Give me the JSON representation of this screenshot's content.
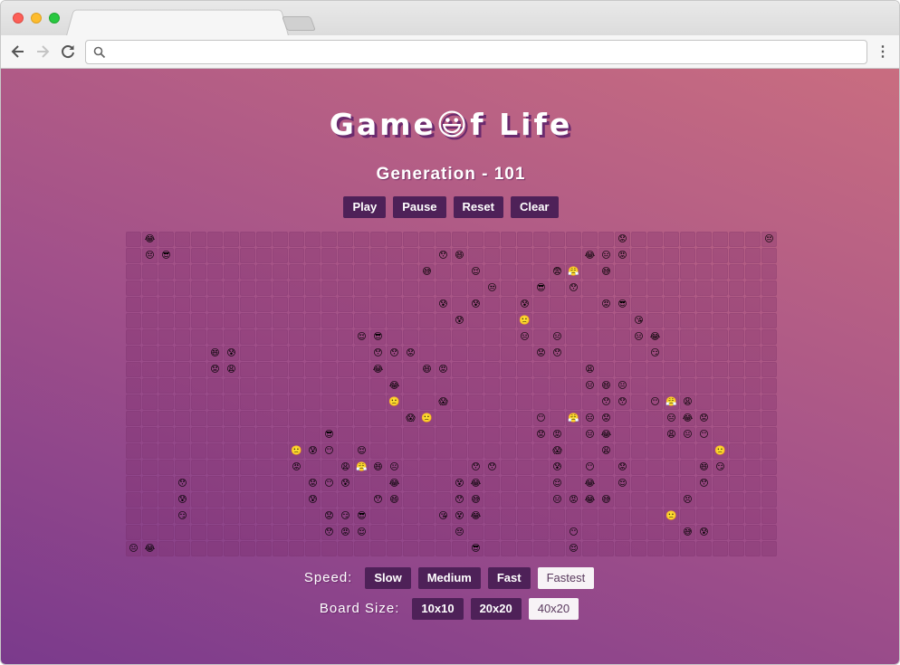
{
  "browser": {
    "url": "",
    "icons": {
      "back": "arrow-left-icon",
      "forward": "arrow-right-icon",
      "reload": "reload-icon",
      "search": "search-icon",
      "menu": "kebab-menu-icon"
    }
  },
  "game": {
    "title_a": "Game",
    "title_emoji": "😃",
    "title_b": "f Life",
    "generation_label": "Generation - 101",
    "controls": {
      "play": "Play",
      "pause": "Pause",
      "reset": "Reset",
      "clear": "Clear"
    },
    "speed": {
      "label": "Speed:",
      "options": [
        "Slow",
        "Medium",
        "Fast",
        "Fastest"
      ],
      "selected": "Fastest"
    },
    "board_size": {
      "label": "Board Size:",
      "options": [
        "10x10",
        "20x20",
        "40x20"
      ],
      "selected": "40x20"
    }
  },
  "board": {
    "cols": 40,
    "rows": 20,
    "alive": [
      [
        0,
        1,
        "😂"
      ],
      [
        0,
        30,
        "😟"
      ],
      [
        0,
        39,
        "😔"
      ],
      [
        1,
        1,
        "😔"
      ],
      [
        1,
        2,
        "😎"
      ],
      [
        1,
        19,
        "😯"
      ],
      [
        1,
        20,
        "😄"
      ],
      [
        1,
        28,
        "😂"
      ],
      [
        1,
        29,
        "😑"
      ],
      [
        1,
        30,
        "😡"
      ],
      [
        2,
        18,
        "😅"
      ],
      [
        2,
        21,
        "😌"
      ],
      [
        2,
        26,
        "😨"
      ],
      [
        2,
        27,
        "😤"
      ],
      [
        2,
        29,
        "😅"
      ],
      [
        3,
        22,
        "😒"
      ],
      [
        3,
        25,
        "😎"
      ],
      [
        3,
        27,
        "😯"
      ],
      [
        4,
        19,
        "😰"
      ],
      [
        4,
        21,
        "😰"
      ],
      [
        4,
        24,
        "😰"
      ],
      [
        4,
        29,
        "😡"
      ],
      [
        4,
        30,
        "😎"
      ],
      [
        5,
        20,
        "😰"
      ],
      [
        5,
        24,
        "🙁"
      ],
      [
        5,
        31,
        "😘"
      ],
      [
        6,
        14,
        "😌"
      ],
      [
        6,
        15,
        "😎"
      ],
      [
        6,
        24,
        "😑"
      ],
      [
        6,
        26,
        "😑"
      ],
      [
        6,
        31,
        "😑"
      ],
      [
        6,
        32,
        "😂"
      ],
      [
        7,
        5,
        "😄"
      ],
      [
        7,
        6,
        "😰"
      ],
      [
        7,
        15,
        "😯"
      ],
      [
        7,
        16,
        "😯"
      ],
      [
        7,
        17,
        "😟"
      ],
      [
        7,
        25,
        "😟"
      ],
      [
        7,
        26,
        "😯"
      ],
      [
        7,
        32,
        "😏"
      ],
      [
        8,
        5,
        "😟"
      ],
      [
        8,
        6,
        "😩"
      ],
      [
        8,
        15,
        "😂"
      ],
      [
        8,
        18,
        "😄"
      ],
      [
        8,
        19,
        "😡"
      ],
      [
        8,
        28,
        "😩"
      ],
      [
        9,
        16,
        "😂"
      ],
      [
        9,
        28,
        "😑"
      ],
      [
        9,
        29,
        "😄"
      ],
      [
        9,
        30,
        "😐"
      ],
      [
        10,
        16,
        "🙁"
      ],
      [
        10,
        19,
        "😱"
      ],
      [
        10,
        29,
        "😯"
      ],
      [
        10,
        30,
        "😯"
      ],
      [
        10,
        32,
        "😶"
      ],
      [
        10,
        33,
        "😤"
      ],
      [
        10,
        34,
        "😩"
      ],
      [
        11,
        17,
        "😱"
      ],
      [
        11,
        18,
        "🙁"
      ],
      [
        11,
        25,
        "😶"
      ],
      [
        11,
        27,
        "😤"
      ],
      [
        11,
        28,
        "😑"
      ],
      [
        11,
        29,
        "😟"
      ],
      [
        11,
        33,
        "😑"
      ],
      [
        11,
        34,
        "😂"
      ],
      [
        11,
        35,
        "😟"
      ],
      [
        12,
        12,
        "😎"
      ],
      [
        12,
        25,
        "😟"
      ],
      [
        12,
        26,
        "😡"
      ],
      [
        12,
        28,
        "😑"
      ],
      [
        12,
        29,
        "😂"
      ],
      [
        12,
        33,
        "😩"
      ],
      [
        12,
        34,
        "😐"
      ],
      [
        12,
        35,
        "😶"
      ],
      [
        13,
        10,
        "🙁"
      ],
      [
        13,
        11,
        "😰"
      ],
      [
        13,
        12,
        "😶"
      ],
      [
        13,
        14,
        "😌"
      ],
      [
        13,
        26,
        "😱"
      ],
      [
        13,
        29,
        "😩"
      ],
      [
        13,
        36,
        "🙁"
      ],
      [
        14,
        10,
        "😡"
      ],
      [
        14,
        13,
        "😩"
      ],
      [
        14,
        14,
        "😤"
      ],
      [
        14,
        15,
        "😄"
      ],
      [
        14,
        16,
        "😐"
      ],
      [
        14,
        21,
        "😯"
      ],
      [
        14,
        22,
        "😯"
      ],
      [
        14,
        26,
        "😰"
      ],
      [
        14,
        28,
        "😶"
      ],
      [
        14,
        30,
        "😟"
      ],
      [
        14,
        35,
        "😄"
      ],
      [
        14,
        36,
        "😏"
      ],
      [
        15,
        3,
        "😯"
      ],
      [
        15,
        11,
        "😟"
      ],
      [
        15,
        12,
        "😶"
      ],
      [
        15,
        13,
        "😰"
      ],
      [
        15,
        16,
        "😂"
      ],
      [
        15,
        20,
        "😵"
      ],
      [
        15,
        21,
        "😂"
      ],
      [
        15,
        26,
        "😌"
      ],
      [
        15,
        28,
        "😂"
      ],
      [
        15,
        30,
        "😌"
      ],
      [
        15,
        35,
        "😯"
      ],
      [
        16,
        3,
        "😰"
      ],
      [
        16,
        11,
        "😰"
      ],
      [
        16,
        15,
        "😯"
      ],
      [
        16,
        16,
        "😄"
      ],
      [
        16,
        20,
        "😯"
      ],
      [
        16,
        21,
        "😅"
      ],
      [
        16,
        26,
        "😑"
      ],
      [
        16,
        27,
        "😡"
      ],
      [
        16,
        28,
        "😂"
      ],
      [
        16,
        29,
        "😅"
      ],
      [
        16,
        34,
        "😣"
      ],
      [
        17,
        3,
        "😏"
      ],
      [
        17,
        12,
        "😟"
      ],
      [
        17,
        13,
        "😏"
      ],
      [
        17,
        14,
        "😎"
      ],
      [
        17,
        19,
        "😘"
      ],
      [
        17,
        20,
        "😵"
      ],
      [
        17,
        21,
        "😂"
      ],
      [
        17,
        33,
        "🙁"
      ],
      [
        18,
        12,
        "😯"
      ],
      [
        18,
        13,
        "😡"
      ],
      [
        18,
        14,
        "😌"
      ],
      [
        18,
        20,
        "😔"
      ],
      [
        18,
        27,
        "😶"
      ],
      [
        18,
        34,
        "😅"
      ],
      [
        18,
        35,
        "😰"
      ],
      [
        19,
        0,
        "😐"
      ],
      [
        19,
        1,
        "😂"
      ],
      [
        19,
        21,
        "😎"
      ],
      [
        19,
        27,
        "😌"
      ]
    ]
  }
}
